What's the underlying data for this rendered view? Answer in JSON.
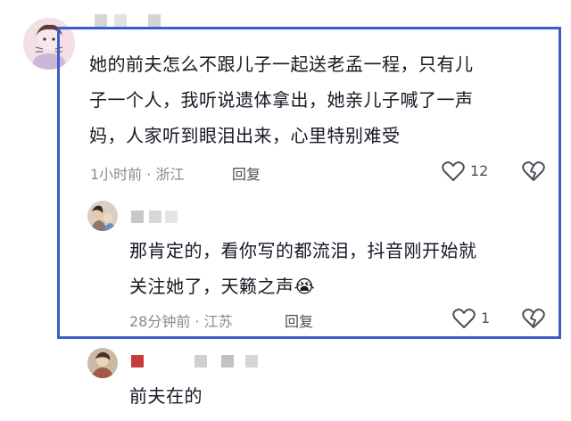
{
  "comments": [
    {
      "text": "她的前夫怎么不跟儿子一起送老孟一程，只有儿子一个人，我听说遗体拿出，她亲儿子喊了一声妈，人家听到眼泪出来，心里特别难受",
      "lines": [
        "她的前夫怎么不跟儿子一起送老孟一程，只有儿",
        "子一个人，我听说遗体拿出，她亲儿子喊了一声",
        "妈，人家听到眼泪出来，心里特别难受"
      ],
      "meta": "1小时前 · 浙江",
      "reply_label": "回复",
      "like_count": "12",
      "reply": {
        "lines": [
          "那肯定的，看你写的都流泪，抖音刚开始就",
          "关注她了，天籁之声"
        ],
        "emoji": "😭",
        "meta": "28分钟前 · 江苏",
        "reply_label": "回复",
        "like_count": "1"
      }
    },
    {
      "text": "前夫在的"
    }
  ],
  "colors": {
    "highlight": "#3a5fc8",
    "meta_gray": "#8a8b91"
  },
  "icons": [
    "heart-icon",
    "broken-heart-icon",
    "crying-emoji"
  ]
}
